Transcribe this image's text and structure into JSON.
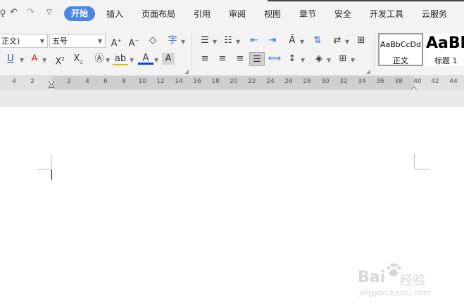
{
  "menu": {
    "tabs": [
      "开始",
      "插入",
      "页面布局",
      "引用",
      "审阅",
      "视图",
      "章节",
      "安全",
      "开发工具",
      "云服务"
    ]
  },
  "font": {
    "name": "正文)",
    "size": "五号"
  },
  "styles": {
    "normal": {
      "preview": "AaBbCcDd",
      "label": "正文"
    },
    "heading1": {
      "preview": "AaBb",
      "label": "标题 1"
    }
  },
  "ruler": {
    "ticks": [
      "4",
      "2",
      "2",
      "4",
      "6",
      "8",
      "10",
      "12",
      "14",
      "16",
      "18",
      "20",
      "22",
      "24",
      "26",
      "28",
      "30",
      "32",
      "34",
      "36",
      "38",
      "40",
      "42",
      "44"
    ]
  },
  "watermark": {
    "brand": "Bai",
    "sub": "经验",
    "url": "jingyan.baidu.com"
  },
  "colors": {
    "accent": "#4a86e8",
    "font_color": "#1a3fd6"
  }
}
